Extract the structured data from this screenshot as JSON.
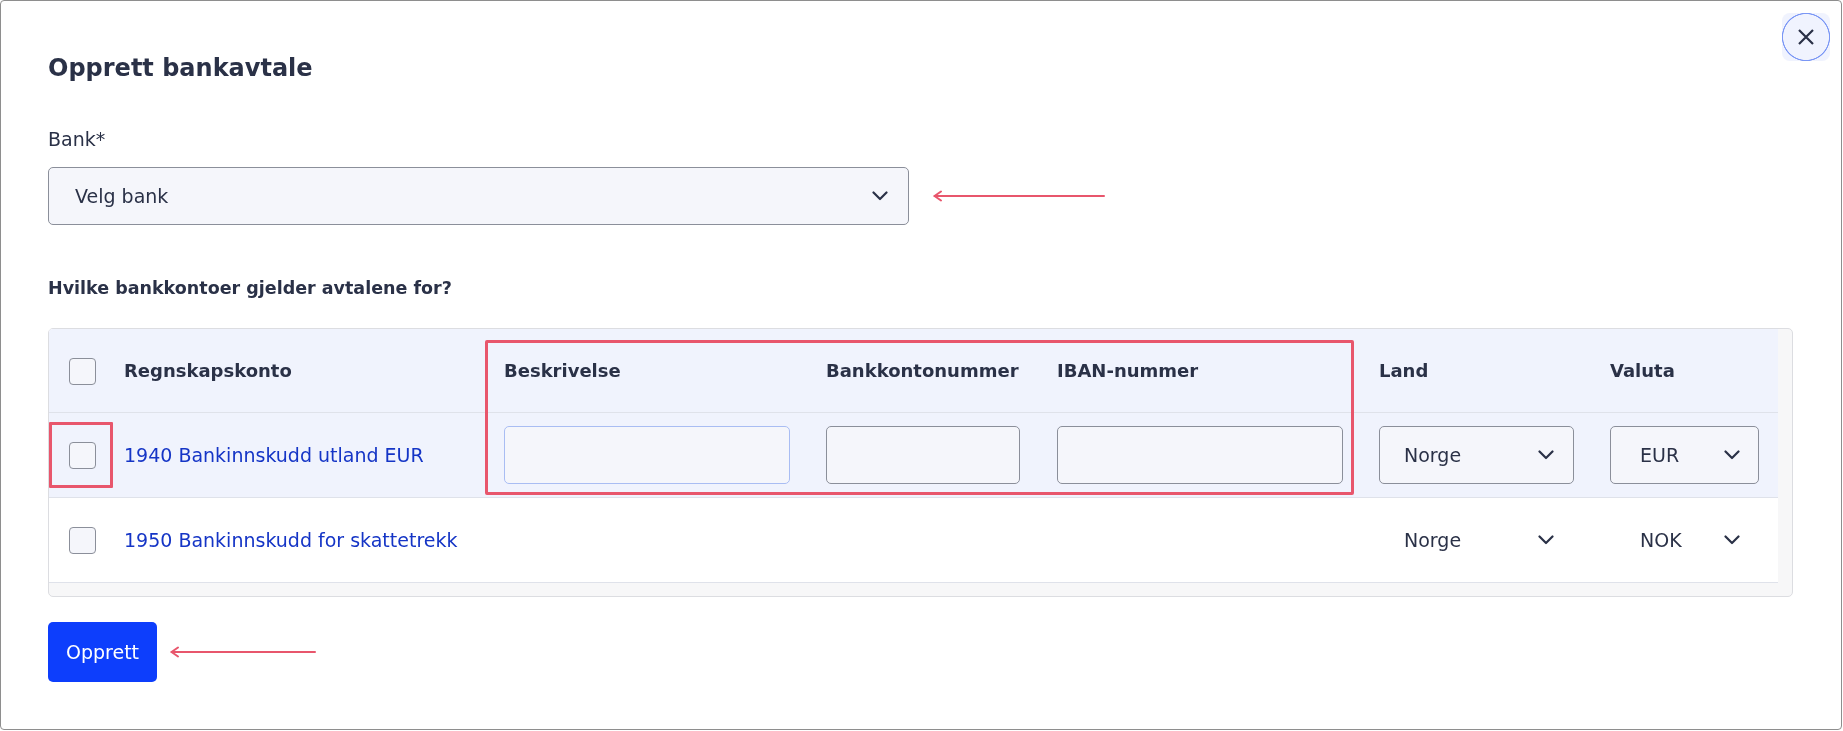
{
  "dialog": {
    "title": "Opprett bankavtale"
  },
  "bank_field": {
    "label": "Bank*",
    "value": "Velg bank",
    "highlighted": true
  },
  "accounts": {
    "heading": "Hvilke bankkontoer gjelder avtalene for?",
    "select_all": {
      "checked": false
    },
    "columns": [
      {
        "label": "Regnskapskonto",
        "highlighted": false
      },
      {
        "label": "Beskrivelse",
        "highlighted": true
      },
      {
        "label": "Bankkontonummer",
        "highlighted": true
      },
      {
        "label": "IBAN-nummer",
        "highlighted": true
      },
      {
        "label": "Land",
        "highlighted": false
      },
      {
        "label": "Valuta",
        "highlighted": false
      }
    ],
    "rows": [
      {
        "checked": false,
        "highlighted": true,
        "editing": true,
        "description_focused": true,
        "account": "1940 Bankinnskudd utland EUR",
        "country": "Norge",
        "currency": "EUR"
      },
      {
        "checked": false,
        "highlighted": false,
        "editing": false,
        "account": "1950 Bankinnskudd for skattetrekk",
        "country": "Norge",
        "currency": "NOK"
      }
    ]
  },
  "submit_button": {
    "label": "Opprett",
    "highlighted": true
  }
}
